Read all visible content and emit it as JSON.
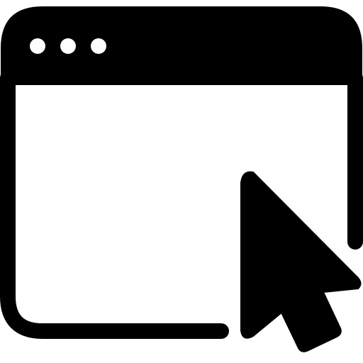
{
  "icon": {
    "name": "browser-window-cursor-icon",
    "parts": [
      "window-frame",
      "title-bar",
      "window-control-dots",
      "mouse-pointer"
    ],
    "window_control_dot_count": 3
  },
  "colors": {
    "foreground": "#000000",
    "background": "#ffffff",
    "dot_fill": "#ffffff"
  }
}
